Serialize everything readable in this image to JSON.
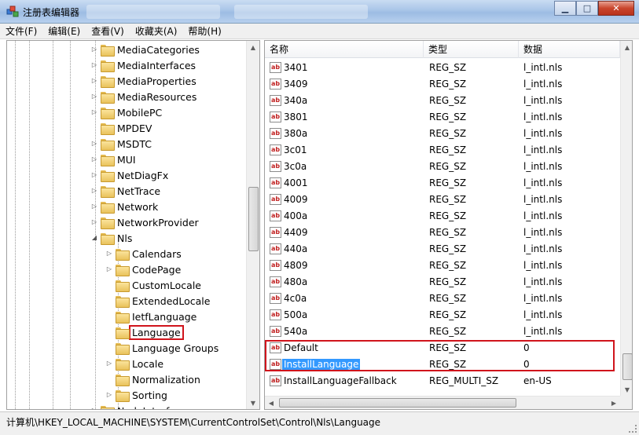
{
  "window": {
    "title": "注册表编辑器",
    "buttons": [
      "minimize-icon",
      "maximize-icon",
      "close-icon"
    ]
  },
  "menu": [
    "文件(F)",
    "编辑(E)",
    "查看(V)",
    "收藏夹(A)",
    "帮助(H)"
  ],
  "tree": {
    "items": [
      {
        "label": "MediaCategories",
        "expandable": true
      },
      {
        "label": "MediaInterfaces",
        "expandable": true
      },
      {
        "label": "MediaProperties",
        "expandable": true
      },
      {
        "label": "MediaResources",
        "expandable": true
      },
      {
        "label": "MobilePC",
        "expandable": true
      },
      {
        "label": "MPDEV",
        "expandable": false
      },
      {
        "label": "MSDTC",
        "expandable": true
      },
      {
        "label": "MUI",
        "expandable": true
      },
      {
        "label": "NetDiagFx",
        "expandable": true
      },
      {
        "label": "NetTrace",
        "expandable": true
      },
      {
        "label": "Network",
        "expandable": true
      },
      {
        "label": "NetworkProvider",
        "expandable": true
      },
      {
        "label": "Nls",
        "expandable": true,
        "expanded": true
      },
      {
        "label": "Calendars",
        "expandable": true,
        "child": true
      },
      {
        "label": "CodePage",
        "expandable": true,
        "child": true
      },
      {
        "label": "CustomLocale",
        "expandable": false,
        "child": true
      },
      {
        "label": "ExtendedLocale",
        "expandable": false,
        "child": true
      },
      {
        "label": "IetfLanguage",
        "expandable": false,
        "child": true
      },
      {
        "label": "Language",
        "expandable": false,
        "child": true,
        "selected": true
      },
      {
        "label": "Language Groups",
        "expandable": false,
        "child": true
      },
      {
        "label": "Locale",
        "expandable": true,
        "child": true
      },
      {
        "label": "Normalization",
        "expandable": false,
        "child": true
      },
      {
        "label": "Sorting",
        "expandable": true,
        "child": true
      },
      {
        "label": "NodeInterfaces",
        "expandable": true
      }
    ]
  },
  "list": {
    "headers": [
      "名称",
      "类型",
      "数据"
    ],
    "rows": [
      {
        "name": "3401",
        "type": "REG_SZ",
        "data": "l_intl.nls"
      },
      {
        "name": "3409",
        "type": "REG_SZ",
        "data": "l_intl.nls"
      },
      {
        "name": "340a",
        "type": "REG_SZ",
        "data": "l_intl.nls"
      },
      {
        "name": "3801",
        "type": "REG_SZ",
        "data": "l_intl.nls"
      },
      {
        "name": "380a",
        "type": "REG_SZ",
        "data": "l_intl.nls"
      },
      {
        "name": "3c01",
        "type": "REG_SZ",
        "data": "l_intl.nls"
      },
      {
        "name": "3c0a",
        "type": "REG_SZ",
        "data": "l_intl.nls"
      },
      {
        "name": "4001",
        "type": "REG_SZ",
        "data": "l_intl.nls"
      },
      {
        "name": "4009",
        "type": "REG_SZ",
        "data": "l_intl.nls"
      },
      {
        "name": "400a",
        "type": "REG_SZ",
        "data": "l_intl.nls"
      },
      {
        "name": "4409",
        "type": "REG_SZ",
        "data": "l_intl.nls"
      },
      {
        "name": "440a",
        "type": "REG_SZ",
        "data": "l_intl.nls"
      },
      {
        "name": "4809",
        "type": "REG_SZ",
        "data": "l_intl.nls"
      },
      {
        "name": "480a",
        "type": "REG_SZ",
        "data": "l_intl.nls"
      },
      {
        "name": "4c0a",
        "type": "REG_SZ",
        "data": "l_intl.nls"
      },
      {
        "name": "500a",
        "type": "REG_SZ",
        "data": "l_intl.nls"
      },
      {
        "name": "540a",
        "type": "REG_SZ",
        "data": "l_intl.nls"
      },
      {
        "name": "Default",
        "type": "REG_SZ",
        "data": "0"
      },
      {
        "name": "InstallLanguage",
        "type": "REG_SZ",
        "data": "0",
        "selected": true
      },
      {
        "name": "InstallLanguageFallback",
        "type": "REG_MULTI_SZ",
        "data": "en-US"
      }
    ]
  },
  "status": {
    "path": "计算机\\HKEY_LOCAL_MACHINE\\SYSTEM\\CurrentControlSet\\Control\\Nls\\Language"
  },
  "colors": {
    "highlight_frame": "#d0141c",
    "selection": "#3399ff",
    "folder": "#e9c25c"
  }
}
